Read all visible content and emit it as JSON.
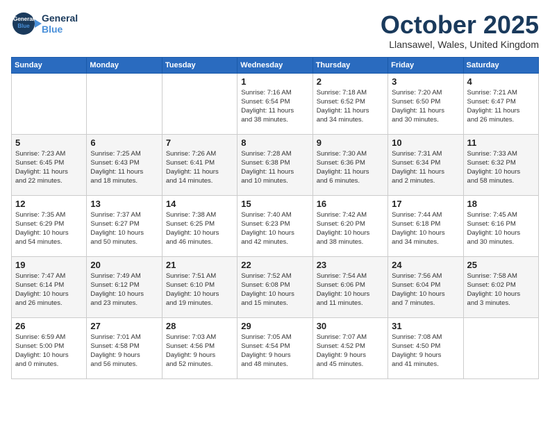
{
  "header": {
    "logo": {
      "general": "General",
      "blue": "Blue"
    },
    "title": "October 2025",
    "location": "Llansawel, Wales, United Kingdom"
  },
  "weekdays": [
    "Sunday",
    "Monday",
    "Tuesday",
    "Wednesday",
    "Thursday",
    "Friday",
    "Saturday"
  ],
  "weeks": [
    [
      {
        "day": "",
        "info": ""
      },
      {
        "day": "",
        "info": ""
      },
      {
        "day": "",
        "info": ""
      },
      {
        "day": "1",
        "info": "Sunrise: 7:16 AM\nSunset: 6:54 PM\nDaylight: 11 hours\nand 38 minutes."
      },
      {
        "day": "2",
        "info": "Sunrise: 7:18 AM\nSunset: 6:52 PM\nDaylight: 11 hours\nand 34 minutes."
      },
      {
        "day": "3",
        "info": "Sunrise: 7:20 AM\nSunset: 6:50 PM\nDaylight: 11 hours\nand 30 minutes."
      },
      {
        "day": "4",
        "info": "Sunrise: 7:21 AM\nSunset: 6:47 PM\nDaylight: 11 hours\nand 26 minutes."
      }
    ],
    [
      {
        "day": "5",
        "info": "Sunrise: 7:23 AM\nSunset: 6:45 PM\nDaylight: 11 hours\nand 22 minutes."
      },
      {
        "day": "6",
        "info": "Sunrise: 7:25 AM\nSunset: 6:43 PM\nDaylight: 11 hours\nand 18 minutes."
      },
      {
        "day": "7",
        "info": "Sunrise: 7:26 AM\nSunset: 6:41 PM\nDaylight: 11 hours\nand 14 minutes."
      },
      {
        "day": "8",
        "info": "Sunrise: 7:28 AM\nSunset: 6:38 PM\nDaylight: 11 hours\nand 10 minutes."
      },
      {
        "day": "9",
        "info": "Sunrise: 7:30 AM\nSunset: 6:36 PM\nDaylight: 11 hours\nand 6 minutes."
      },
      {
        "day": "10",
        "info": "Sunrise: 7:31 AM\nSunset: 6:34 PM\nDaylight: 11 hours\nand 2 minutes."
      },
      {
        "day": "11",
        "info": "Sunrise: 7:33 AM\nSunset: 6:32 PM\nDaylight: 10 hours\nand 58 minutes."
      }
    ],
    [
      {
        "day": "12",
        "info": "Sunrise: 7:35 AM\nSunset: 6:29 PM\nDaylight: 10 hours\nand 54 minutes."
      },
      {
        "day": "13",
        "info": "Sunrise: 7:37 AM\nSunset: 6:27 PM\nDaylight: 10 hours\nand 50 minutes."
      },
      {
        "day": "14",
        "info": "Sunrise: 7:38 AM\nSunset: 6:25 PM\nDaylight: 10 hours\nand 46 minutes."
      },
      {
        "day": "15",
        "info": "Sunrise: 7:40 AM\nSunset: 6:23 PM\nDaylight: 10 hours\nand 42 minutes."
      },
      {
        "day": "16",
        "info": "Sunrise: 7:42 AM\nSunset: 6:20 PM\nDaylight: 10 hours\nand 38 minutes."
      },
      {
        "day": "17",
        "info": "Sunrise: 7:44 AM\nSunset: 6:18 PM\nDaylight: 10 hours\nand 34 minutes."
      },
      {
        "day": "18",
        "info": "Sunrise: 7:45 AM\nSunset: 6:16 PM\nDaylight: 10 hours\nand 30 minutes."
      }
    ],
    [
      {
        "day": "19",
        "info": "Sunrise: 7:47 AM\nSunset: 6:14 PM\nDaylight: 10 hours\nand 26 minutes."
      },
      {
        "day": "20",
        "info": "Sunrise: 7:49 AM\nSunset: 6:12 PM\nDaylight: 10 hours\nand 23 minutes."
      },
      {
        "day": "21",
        "info": "Sunrise: 7:51 AM\nSunset: 6:10 PM\nDaylight: 10 hours\nand 19 minutes."
      },
      {
        "day": "22",
        "info": "Sunrise: 7:52 AM\nSunset: 6:08 PM\nDaylight: 10 hours\nand 15 minutes."
      },
      {
        "day": "23",
        "info": "Sunrise: 7:54 AM\nSunset: 6:06 PM\nDaylight: 10 hours\nand 11 minutes."
      },
      {
        "day": "24",
        "info": "Sunrise: 7:56 AM\nSunset: 6:04 PM\nDaylight: 10 hours\nand 7 minutes."
      },
      {
        "day": "25",
        "info": "Sunrise: 7:58 AM\nSunset: 6:02 PM\nDaylight: 10 hours\nand 3 minutes."
      }
    ],
    [
      {
        "day": "26",
        "info": "Sunrise: 6:59 AM\nSunset: 5:00 PM\nDaylight: 10 hours\nand 0 minutes."
      },
      {
        "day": "27",
        "info": "Sunrise: 7:01 AM\nSunset: 4:58 PM\nDaylight: 9 hours\nand 56 minutes."
      },
      {
        "day": "28",
        "info": "Sunrise: 7:03 AM\nSunset: 4:56 PM\nDaylight: 9 hours\nand 52 minutes."
      },
      {
        "day": "29",
        "info": "Sunrise: 7:05 AM\nSunset: 4:54 PM\nDaylight: 9 hours\nand 48 minutes."
      },
      {
        "day": "30",
        "info": "Sunrise: 7:07 AM\nSunset: 4:52 PM\nDaylight: 9 hours\nand 45 minutes."
      },
      {
        "day": "31",
        "info": "Sunrise: 7:08 AM\nSunset: 4:50 PM\nDaylight: 9 hours\nand 41 minutes."
      },
      {
        "day": "",
        "info": ""
      }
    ]
  ]
}
